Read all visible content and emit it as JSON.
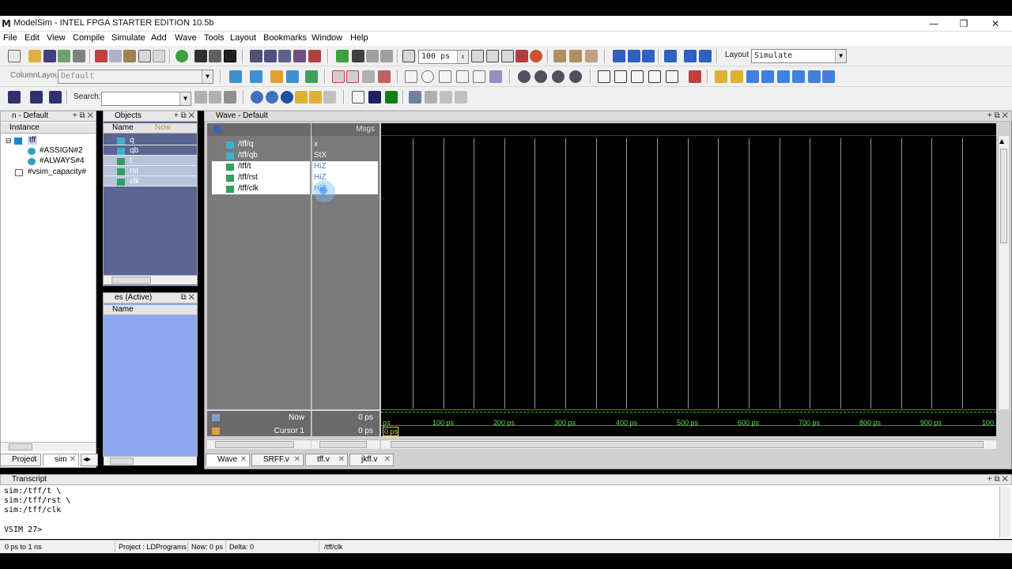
{
  "window": {
    "title": "ModelSim - INTEL FPGA STARTER EDITION 10.5b",
    "logo": "M",
    "controls": [
      "—",
      "❐",
      "✕"
    ]
  },
  "menu": [
    "File",
    "Edit",
    "View",
    "Compile",
    "Simulate",
    "Add",
    "Wave",
    "Tools",
    "Layout",
    "Bookmarks",
    "Window",
    "Help"
  ],
  "toolbar": {
    "run_length": "100 ps",
    "layout_label": "Layout",
    "layout_value": "Simulate",
    "column_layout_label": "ColumnLayout",
    "column_layout_value": "Default",
    "search_label": "Search:",
    "search_value": ""
  },
  "instance_panel": {
    "title": "n - Default",
    "column": "Instance",
    "items": [
      {
        "label": "tff",
        "icon": "module-icon"
      },
      {
        "label": "#ASSIGN#2",
        "icon": "process-icon"
      },
      {
        "label": "#ALWAYS#4",
        "icon": "process-icon"
      },
      {
        "label": "#vsim_capacity#",
        "icon": "capacity-icon"
      }
    ]
  },
  "objects_panel": {
    "title": "Objects",
    "col_name": "Name",
    "col_now": "Now",
    "items": [
      "q",
      "qb",
      "t",
      "rst",
      "clk"
    ]
  },
  "processes_panel": {
    "title": "es (Active)",
    "col_name": "Name"
  },
  "left_tabs": [
    {
      "label": "Project"
    },
    {
      "label": "sim"
    }
  ],
  "wave": {
    "title": "Wave - Default",
    "msgs_header": "Msgs",
    "signals": [
      {
        "name": "/tff/q",
        "value": "x"
      },
      {
        "name": "/tff/qb",
        "value": "StX"
      },
      {
        "name": "/tff/t",
        "value": "HiZ"
      },
      {
        "name": "/tff/rst",
        "value": "HiZ"
      },
      {
        "name": "/tff/clk",
        "value": "HiZ"
      }
    ],
    "now_label": "Now",
    "now_value": "0 ps",
    "cursor_label": "Cursor 1",
    "cursor_value": "0 ps",
    "cursor_marker": "0 ps",
    "timeline_start": "ps",
    "ticks": [
      "100 ps",
      "200 ps",
      "300 ps",
      "400 ps",
      "500 ps",
      "600 ps",
      "700 ps",
      "800 ps",
      "900 ps",
      "100"
    ],
    "colors": {
      "wave_bg": "#000000",
      "timeline": "#5fd95f",
      "cursor": "#f0e040"
    }
  },
  "wave_tabs": [
    {
      "label": "Wave"
    },
    {
      "label": "SRFF.v"
    },
    {
      "label": "tff.v"
    },
    {
      "label": "jkff.v"
    }
  ],
  "transcript": {
    "title": "Transcript",
    "lines": [
      "sim:/tff/t \\",
      "sim:/tff/rst \\",
      "sim:/tff/clk"
    ],
    "prompt": "VSIM 27>"
  },
  "status": {
    "range": "0 ps to 1 ns",
    "project": "Project : LDPrograms",
    "now": "Now: 0 ps",
    "delta": "Delta: 0",
    "path": "/tff/clk"
  }
}
